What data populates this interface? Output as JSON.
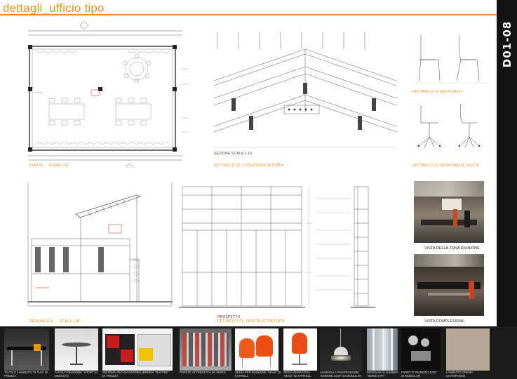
{
  "page": {
    "title": "dettagli_ufficio tipo",
    "sheet_code": "D01-08"
  },
  "drawings": {
    "pianta": {
      "caption": "PIANTA",
      "scale": "SCALA 1:50"
    },
    "copertura": {
      "caption": "DETTAGLIO 02: COPERTURA VETRATA",
      "scale": "SEZIONE     SCALA 1:10"
    },
    "seduta_1": {
      "caption": "DETTAGLIO DI SEDIA KAKU"
    },
    "seduta_2": {
      "caption": "DETTAGLIO DI SEDIA KAKU E RUOTE"
    },
    "sezione": {
      "caption": "SEZIONE A-A",
      "scale": "SCALA 1:50"
    },
    "parete": {
      "caption": "DETTAGLIO 01: PARETE ATTREZZATA",
      "scale": "PROSPETTO"
    }
  },
  "renders": [
    {
      "caption": "VISTA DELLA ZONA RIUNIONE"
    },
    {
      "caption": "VISTA COMPLESSIVA"
    }
  ],
  "catalog": [
    {
      "caption": "TAVOLO LAMINATO \"B-TUS\" DI PREZZA"
    },
    {
      "caption": "TAVOLO RIUNIONE \"HTOR\" DI DESALTO"
    },
    {
      "caption": "SISTEMA ARCHIVIAZIONE/LIBRERIA \"RAFFEE\" DI FREZZA"
    },
    {
      "caption": "PARETE ATTREZZATA 2S SORIO"
    },
    {
      "caption": "SEDIA PER RIUNIONE \"MAUI\" DI KARTELL"
    },
    {
      "caption": "SEDIA OPERATIVA \"MAUI\" DI KARTELL"
    },
    {
      "caption": "LAMPADA A SOSPENSIONE \"DOMINE LOW\" DI MODULAR"
    },
    {
      "caption": "INFISSI IN ALLUMINIO \"SERIE 5 PA\""
    },
    {
      "caption": "FARETTI \"NUMERO EYE\" DI MODULAR"
    },
    {
      "caption": "LAMINATO CREMA CHAMPAGNE"
    }
  ]
}
